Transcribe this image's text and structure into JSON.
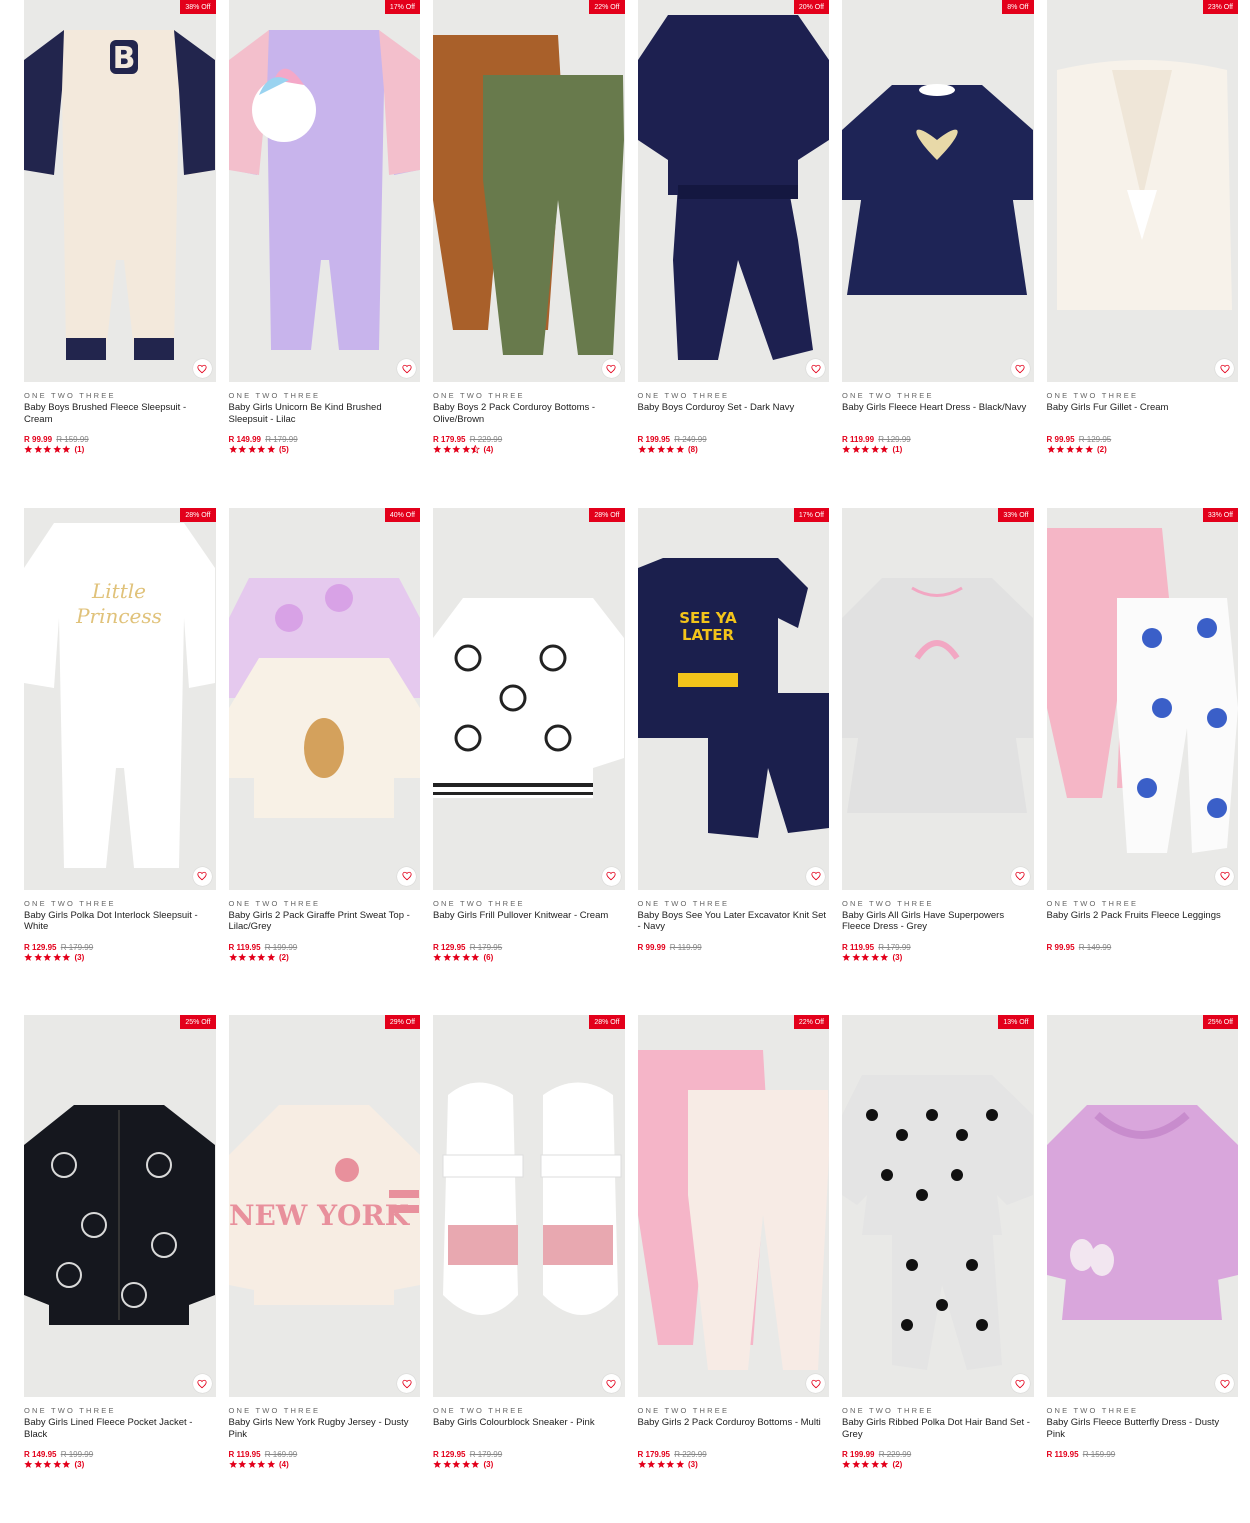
{
  "colors": {
    "accent": "#e3001b",
    "image_bg": "#e9e9e7"
  },
  "products": [
    {
      "badge": "38% Off",
      "brand": "ONE TWO THREE",
      "name": "Baby Boys Brushed Fleece Sleepsuit - Cream",
      "price": "R 99.99",
      "was": "R 159.99",
      "rating": 5,
      "count": "(1)",
      "art": "sleepsuit-b",
      "palette": [
        "#f3e9dc",
        "#22254d"
      ]
    },
    {
      "badge": "17% Off",
      "brand": "ONE TWO THREE",
      "name": "Baby Girls Unicorn Be Kind Brushed Sleepsuit - Lilac",
      "price": "R 149.99",
      "was": "R 179.99",
      "rating": 5,
      "count": "(5)",
      "art": "sleepsuit-unicorn",
      "palette": [
        "#c8b4ec",
        "#f3bfcc"
      ]
    },
    {
      "badge": "22% Off",
      "brand": "ONE TWO THREE",
      "name": "Baby Boys 2 Pack Corduroy Bottoms - Olive/Brown",
      "price": "R 179.95",
      "was": "R 229.99",
      "rating": 4.5,
      "count": "(4)",
      "art": "two-pants",
      "palette": [
        "#a9602a",
        "#687a4c"
      ]
    },
    {
      "badge": "20% Off",
      "brand": "ONE TWO THREE",
      "name": "Baby Boys Corduroy Set - Dark Navy",
      "price": "R 199.95",
      "was": "R 249.99",
      "rating": 5,
      "count": "(8)",
      "art": "top-pants",
      "palette": [
        "#1d2050",
        "#1d2050"
      ]
    },
    {
      "badge": "8% Off",
      "brand": "ONE TWO THREE",
      "name": "Baby Girls Fleece Heart Dress - Black/Navy",
      "price": "R 119.99",
      "was": "R 129.99",
      "rating": 5,
      "count": "(1)",
      "art": "dress-heart",
      "palette": [
        "#1e2456",
        "#e8d9a8"
      ]
    },
    {
      "badge": "23% Off",
      "brand": "ONE TWO THREE",
      "name": "Baby Girls Fur Gillet - Cream",
      "price": "R 99.95",
      "was": "R 129.95",
      "rating": 5,
      "count": "(2)",
      "art": "gilet",
      "palette": [
        "#f7f2ea",
        "#efe6d8"
      ]
    },
    {
      "badge": "28% Off",
      "brand": "ONE TWO THREE",
      "name": "Baby Girls Polka Dot Interlock Sleepsuit - White",
      "price": "R 129.95",
      "was": "R 179.99",
      "rating": 5,
      "count": "(3)",
      "art": "sleepsuit-white",
      "palette": [
        "#ffffff",
        "#e0c27a"
      ]
    },
    {
      "badge": "40% Off",
      "brand": "ONE TWO THREE",
      "name": "Baby Girls 2 Pack Giraffe Print Sweat Top - Lilac/Grey",
      "price": "R 119.95",
      "was": "R 199.99",
      "rating": 5,
      "count": "(2)",
      "art": "two-tops",
      "palette": [
        "#e5c9ee",
        "#f8f1e6"
      ]
    },
    {
      "badge": "28% Off",
      "brand": "ONE TWO THREE",
      "name": "Baby Girls Frill Pullover Knitwear - Cream",
      "price": "R 129.95",
      "was": "R 179.95",
      "rating": 5,
      "count": "(6)",
      "art": "knit-top",
      "palette": [
        "#ffffff",
        "#222222"
      ]
    },
    {
      "badge": "17% Off",
      "brand": "ONE TWO THREE",
      "name": "Baby Boys See You Later Excavator Knit Set - Navy",
      "price": "R 99.99",
      "was": "R 119.99",
      "rating": 0,
      "count": "",
      "art": "tee-shorts",
      "palette": [
        "#1b1f4d",
        "#f3c41a"
      ]
    },
    {
      "badge": "33% Off",
      "brand": "ONE TWO THREE",
      "name": "Baby Girls All Girls Have Superpowers Fleece Dress - Grey",
      "price": "R 119.95",
      "was": "R 179.99",
      "rating": 5,
      "count": "(3)",
      "art": "dress-grey",
      "palette": [
        "#e1e1e1",
        "#f2a7c3"
      ]
    },
    {
      "badge": "33% Off",
      "brand": "ONE TWO THREE",
      "name": "Baby Girls 2 Pack Fruits Fleece Leggings",
      "price": "R 99.95",
      "was": "R 149.99",
      "rating": 0,
      "count": "",
      "art": "leggings",
      "palette": [
        "#f5b6c6",
        "#3a5fc8"
      ]
    },
    {
      "badge": "25% Off",
      "brand": "ONE TWO THREE",
      "name": "Baby Girls Lined Fleece Pocket Jacket - Black",
      "price": "R 149.95",
      "was": "R 199.99",
      "rating": 5,
      "count": "(3)",
      "art": "jacket",
      "palette": [
        "#15171e",
        "#d9d9d9"
      ]
    },
    {
      "badge": "29% Off",
      "brand": "ONE TWO THREE",
      "name": "Baby Girls New York Rugby Jersey - Dusty Pink",
      "price": "R 119.95",
      "was": "R 169.99",
      "rating": 5,
      "count": "(4)",
      "art": "rugby",
      "palette": [
        "#f7ede3",
        "#e8909c"
      ]
    },
    {
      "badge": "28% Off",
      "brand": "ONE TWO THREE",
      "name": "Baby Girls Colourblock Sneaker - Pink",
      "price": "R 129.95",
      "was": "R 179.99",
      "rating": 5,
      "count": "(3)",
      "art": "sneakers",
      "palette": [
        "#ffffff",
        "#e8a8b0"
      ]
    },
    {
      "badge": "22% Off",
      "brand": "ONE TWO THREE",
      "name": "Baby Girls 2 Pack Corduroy Bottoms - Multi",
      "price": "R 179.95",
      "was": "R 229.99",
      "rating": 5,
      "count": "(3)",
      "art": "two-pants",
      "palette": [
        "#f5b5c8",
        "#f7ebe5"
      ]
    },
    {
      "badge": "13% Off",
      "brand": "ONE TWO THREE",
      "name": "Baby Girls Ribbed Polka Dot Hair Band Set - Grey",
      "price": "R 199.99",
      "was": "R 229.99",
      "rating": 5,
      "count": "(2)",
      "art": "polka-set",
      "palette": [
        "#e4e4e4",
        "#111111"
      ]
    },
    {
      "badge": "25% Off",
      "brand": "ONE TWO THREE",
      "name": "Baby Girls Fleece Butterfly Dress - Dusty Pink",
      "price": "R 119.95",
      "was": "R 159.99",
      "rating": 0,
      "count": "",
      "art": "dress-pink",
      "palette": [
        "#d9a6dc",
        "#f2e6f0"
      ]
    }
  ]
}
